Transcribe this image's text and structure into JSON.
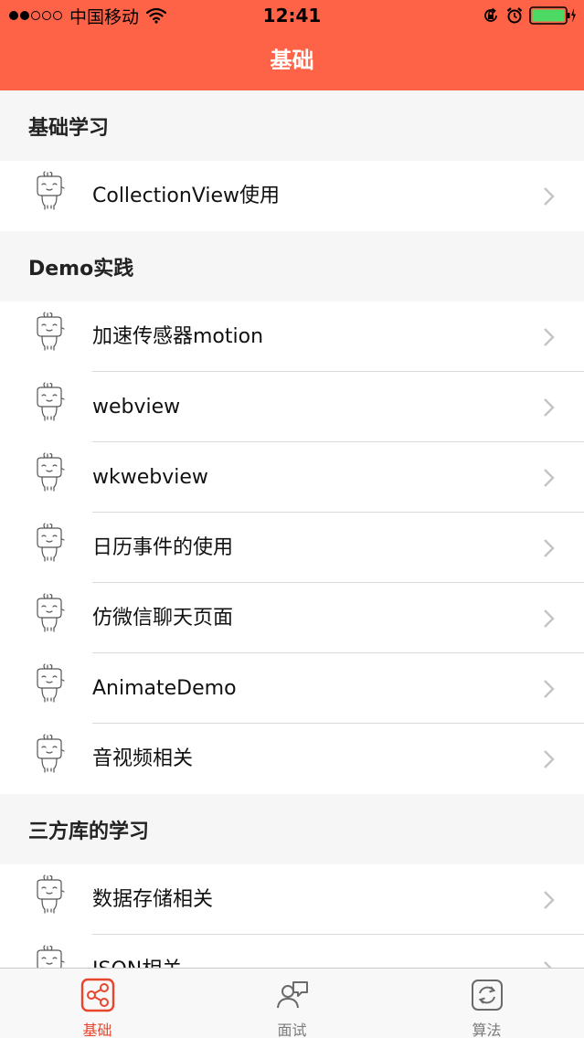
{
  "status_bar": {
    "carrier": "中国移动",
    "time": "12:41"
  },
  "nav": {
    "title": "基础"
  },
  "sections": [
    {
      "title": "基础学习",
      "items": [
        "CollectionView使用"
      ]
    },
    {
      "title": "Demo实践",
      "items": [
        "加速传感器motion",
        "webview",
        "wkwebview",
        "日历事件的使用",
        "仿微信聊天页面",
        "AnimateDemo",
        "音视频相关"
      ]
    },
    {
      "title": "三方库的学习",
      "items": [
        "数据存储相关",
        "JSON相关"
      ]
    }
  ],
  "tabs": [
    {
      "label": "基础",
      "icon": "share-nodes-icon",
      "active": true
    },
    {
      "label": "面试",
      "icon": "interview-chat-icon",
      "active": false
    },
    {
      "label": "算法",
      "icon": "refresh-box-icon",
      "active": false
    }
  ],
  "colors": {
    "nav_background": "#FF6347",
    "section_background": "#F6F6F6",
    "tab_active": "#E8452C",
    "tab_inactive": "#7A7A7A"
  }
}
